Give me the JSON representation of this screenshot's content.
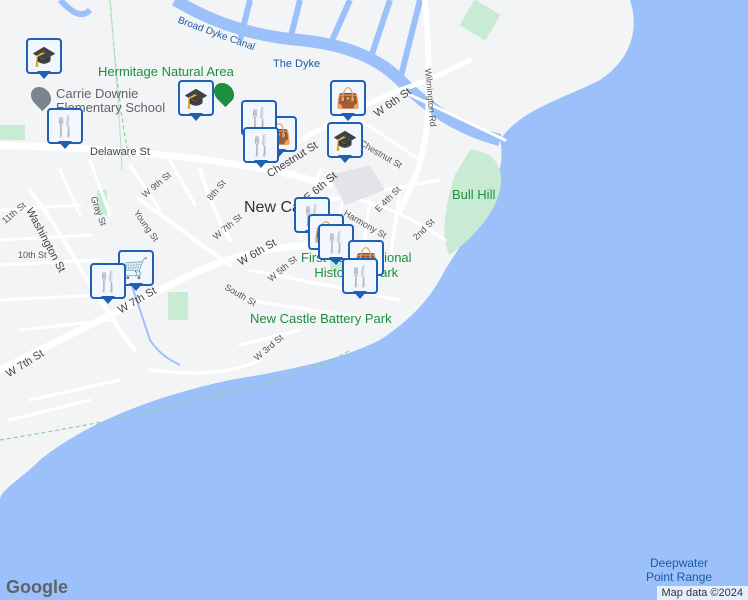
{
  "map": {
    "colors": {
      "water": "#9cc0f9",
      "land": "#f3f4f6",
      "park": "#c9ead3",
      "road": "#ffffff",
      "road_edge": "#d8dce3"
    },
    "labels": {
      "broad_dyke_canal": "Broad Dyke Canal",
      "the_dyke": "The Dyke",
      "hermitage": "Hermitage Natural Area",
      "school": "Carrie Downie\nElementary School",
      "delaware_st": "Delaware St",
      "chestnut_st": "Chestnut St",
      "chestnut_st2": "Chestnut St",
      "w6th_top": "W 6th St",
      "e6th": "E 6th St",
      "w6th_mid": "W 6th St",
      "w7th_bottom": "W 7th St",
      "w7th_mid": "W 7th St",
      "w7th_small": "W 7th St",
      "w9th": "W 9th St",
      "eighth": "8th St",
      "eleventh": "11th St",
      "tenth": "10th St",
      "washington": "Washington St",
      "gray": "Gray St",
      "young": "Young St",
      "w5th": "W 5th St",
      "south": "South St",
      "w3rd": "W 3rd St",
      "harmony": "Harmony St",
      "e4th": "E 4th St",
      "second": "2nd St",
      "wilmington": "Wilmington Rd",
      "new_castle": "New Castle",
      "first_state": "First State National\nHistorical Park",
      "battery_park": "New Castle Battery Park",
      "bull_hill": "Bull Hill",
      "deepwater": "Deepwater\nPoint Range"
    },
    "markers": [
      {
        "name": "school-marker-nw",
        "icon": "graduation-cap-icon",
        "glyph": "🎓"
      },
      {
        "name": "school-marker-hermitage",
        "icon": "graduation-cap-icon",
        "glyph": "🎓"
      },
      {
        "name": "school-marker-chestnut",
        "icon": "graduation-cap-icon",
        "glyph": "🎓"
      },
      {
        "name": "shopping-marker-top",
        "icon": "shopping-bag-icon",
        "glyph": "👜"
      },
      {
        "name": "shopping-marker-chestnut",
        "icon": "shopping-bag-icon",
        "glyph": "👜"
      },
      {
        "name": "restaurant-marker-school",
        "icon": "fork-knife-icon",
        "glyph": "🍴"
      },
      {
        "name": "restaurant-marker-chestnut-1",
        "icon": "fork-knife-icon",
        "glyph": "🍴"
      },
      {
        "name": "restaurant-marker-chestnut-2",
        "icon": "fork-knife-icon",
        "glyph": "🍴"
      },
      {
        "name": "restaurant-marker-newcastle",
        "icon": "fork-knife-icon",
        "glyph": "🍴"
      },
      {
        "name": "shopping-marker-newcastle",
        "icon": "shopping-bag-icon",
        "glyph": "👜"
      },
      {
        "name": "restaurant-marker-center",
        "icon": "fork-knife-icon",
        "glyph": "🍴"
      },
      {
        "name": "shopping-marker-park",
        "icon": "shopping-bag-icon",
        "glyph": "👜"
      },
      {
        "name": "restaurant-marker-park",
        "icon": "fork-knife-icon",
        "glyph": "🍴"
      },
      {
        "name": "grocery-marker",
        "icon": "shopping-cart-icon",
        "glyph": "🛒"
      },
      {
        "name": "restaurant-marker-west",
        "icon": "fork-knife-icon",
        "glyph": "🍴"
      }
    ],
    "attribution": "Map data ©2024",
    "logo": "Google"
  }
}
